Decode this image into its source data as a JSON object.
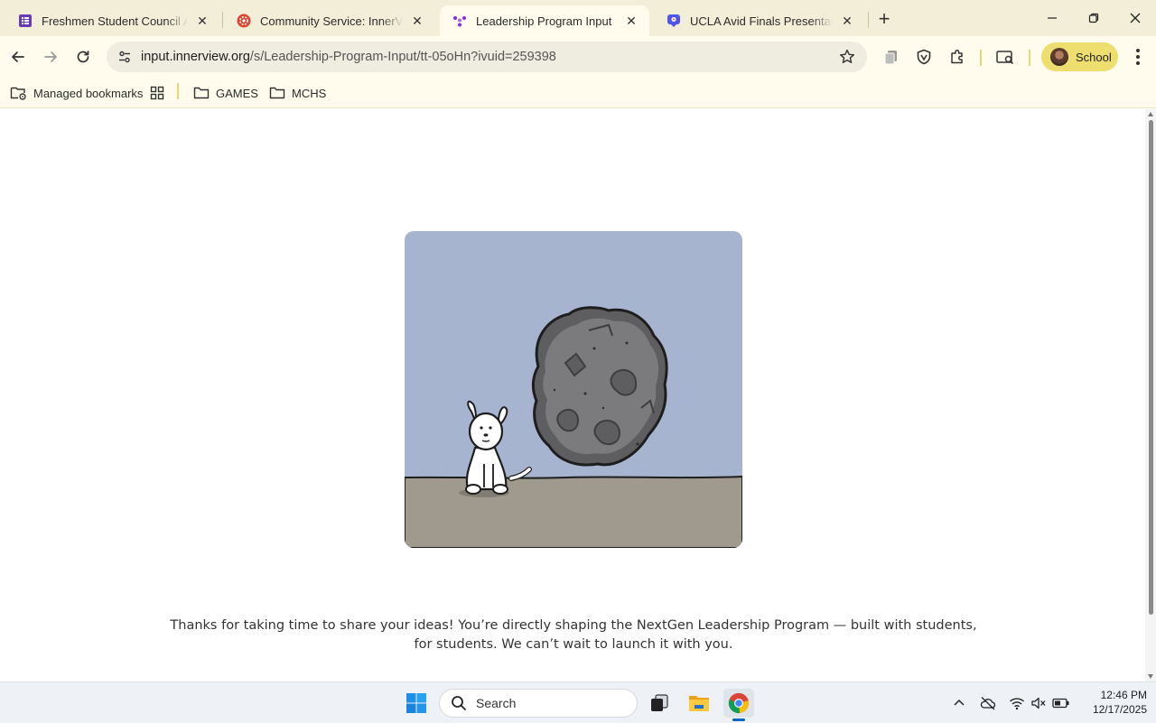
{
  "browser": {
    "tabs": [
      {
        "title": "Freshmen Student Council Application",
        "favicon": "forms-icon",
        "color": "#673ab7",
        "active": false
      },
      {
        "title": "Community Service: InnerView",
        "favicon": "innerview-icon",
        "color": "#e2432e",
        "active": false
      },
      {
        "title": "Leadership Program Input",
        "favicon": "innerview-dots-icon",
        "color": "#8a2be2",
        "active": true
      },
      {
        "title": "UCLA Avid Finals Presentation",
        "favicon": "presentation-icon",
        "color": "#4f55e8",
        "active": false
      }
    ],
    "close_glyph": "✕",
    "new_tab_glyph": "+",
    "address": {
      "host": "input.innerview.org",
      "path": "/s/Leadership-Program-Input/tt-05oHn?ivuid=259398"
    },
    "profile_label": "School",
    "bookmarks": [
      {
        "label": "Managed bookmarks",
        "icon": "managed-folder-icon"
      },
      {
        "label": "",
        "icon": "apps-grid-icon"
      },
      {
        "label": "GAMES",
        "icon": "folder-icon"
      },
      {
        "label": "MCHS",
        "icon": "folder-icon"
      }
    ]
  },
  "page": {
    "message": "Thanks for taking  time to share your ideas! You’re directly shaping the NextGen Leadership Program — built with students, for students. We can’t wait to launch it with you.",
    "illustration": {
      "sky": "#a7b4d0",
      "ground": "#a09a8e",
      "rock": "#5e5e60"
    }
  },
  "taskbar": {
    "search_placeholder": "Search",
    "time": "12:46 PM",
    "date": "12/17/2025"
  },
  "colors": {
    "tabstrip": "#f2eed7",
    "toolbar": "#fffcee",
    "accent": "#eedd6f"
  }
}
